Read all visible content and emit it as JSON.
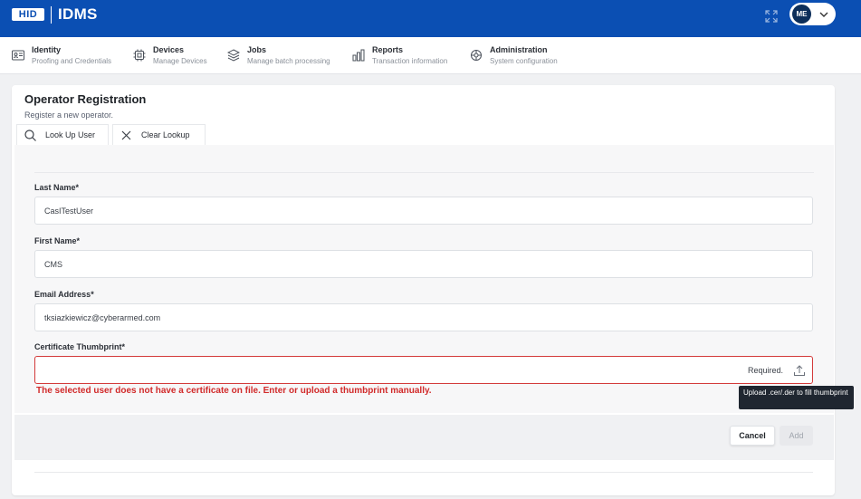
{
  "header": {
    "logo_badge": "HID",
    "app_name": "IDMS",
    "user_initials": "ME",
    "brand_color": "#0b4fb3"
  },
  "nav": [
    {
      "title": "Identity",
      "subtitle": "Proofing and Credentials",
      "icon": "id-card-icon"
    },
    {
      "title": "Devices",
      "subtitle": "Manage Devices",
      "icon": "chip-icon"
    },
    {
      "title": "Jobs",
      "subtitle": "Manage batch processing",
      "icon": "layers-icon"
    },
    {
      "title": "Reports",
      "subtitle": "Transaction information",
      "icon": "bar-chart-icon"
    },
    {
      "title": "Administration",
      "subtitle": "System configuration",
      "icon": "settings-wheel-icon"
    }
  ],
  "page": {
    "title": "Operator Registration",
    "subtitle": "Register a new operator."
  },
  "toolbar": {
    "lookup_label": "Look Up User",
    "clear_label": "Clear Lookup"
  },
  "form": {
    "last_name_label": "Last Name*",
    "last_name_value": "CasITestUser",
    "first_name_label": "First Name*",
    "first_name_value": "CMS",
    "email_label": "Email Address*",
    "email_value": "tksiazkiewicz@cyberarmed.com",
    "thumbprint_label": "Certificate Thumbprint*",
    "thumbprint_value": "",
    "thumbprint_required": "Required.",
    "error_message": "The selected user does not have a certificate on file. Enter or upload a thumbprint manually.",
    "upload_tooltip": "Upload .cer/.der to fill thumbprint",
    "error_color": "#d12a2a"
  },
  "actions": {
    "cancel_label": "Cancel",
    "add_label": "Add"
  }
}
